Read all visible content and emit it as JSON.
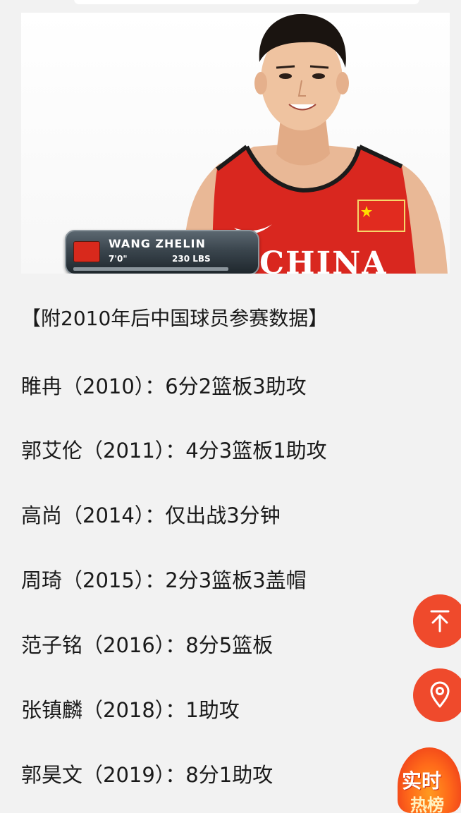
{
  "photo": {
    "lower_third": {
      "name": "WANG ZHELIN",
      "height": "7'0\"",
      "weight": "230 LBS"
    },
    "jersey_text": "CHINA"
  },
  "article": {
    "heading": "【附2010年后中国球员参赛数据】",
    "stats": [
      "睢冉（2010）：6分2篮板3助攻",
      "郭艾伦（2011）：4分3篮板1助攻",
      "高尚（2014）：仅出战3分钟",
      "周琦（2015）：2分3篮板3盖帽",
      "范子铭（2016）：8分5篮板",
      "张镇麟（2018）：1助攻",
      "郭昊文（2019）：8分1助攻"
    ]
  },
  "floating": {
    "top_button_icon": "arrow-up-icon",
    "location_button_icon": "location-pin-icon",
    "hot_badge_line1": "实时",
    "hot_badge_line2": "热榜",
    "accent_color": "#ef4a2c"
  }
}
